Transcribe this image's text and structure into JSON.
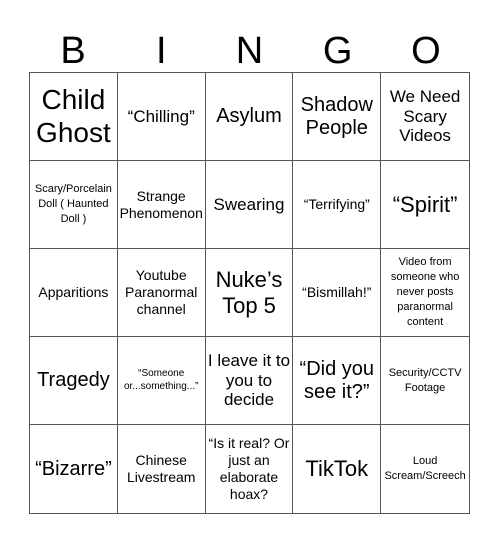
{
  "header": [
    "B",
    "I",
    "N",
    "G",
    "O"
  ],
  "cells": [
    "Child Ghost",
    "“Chilling”",
    "Asylum",
    "Shadow People",
    "We Need Scary Videos",
    "Scary/Porcelain Doll ( Haunted Doll )",
    "Strange Phenomenon",
    "Swearing",
    "“Terrifying”",
    "“Spirit”",
    "Apparitions",
    "Youtube Paranormal channel",
    "Nuke’s Top 5",
    "“Bismillah!”",
    "Video from someone who never posts paranormal content",
    "Tragedy",
    "“Someone or...something...”",
    "I leave it to you to decide",
    "“Did you see it?”",
    "Security/CCTV Footage",
    "“Bizarre”",
    "Chinese Livestream",
    "“Is it real? Or just an elaborate hoax?",
    "TikTok",
    "Loud Scream/Screech"
  ]
}
